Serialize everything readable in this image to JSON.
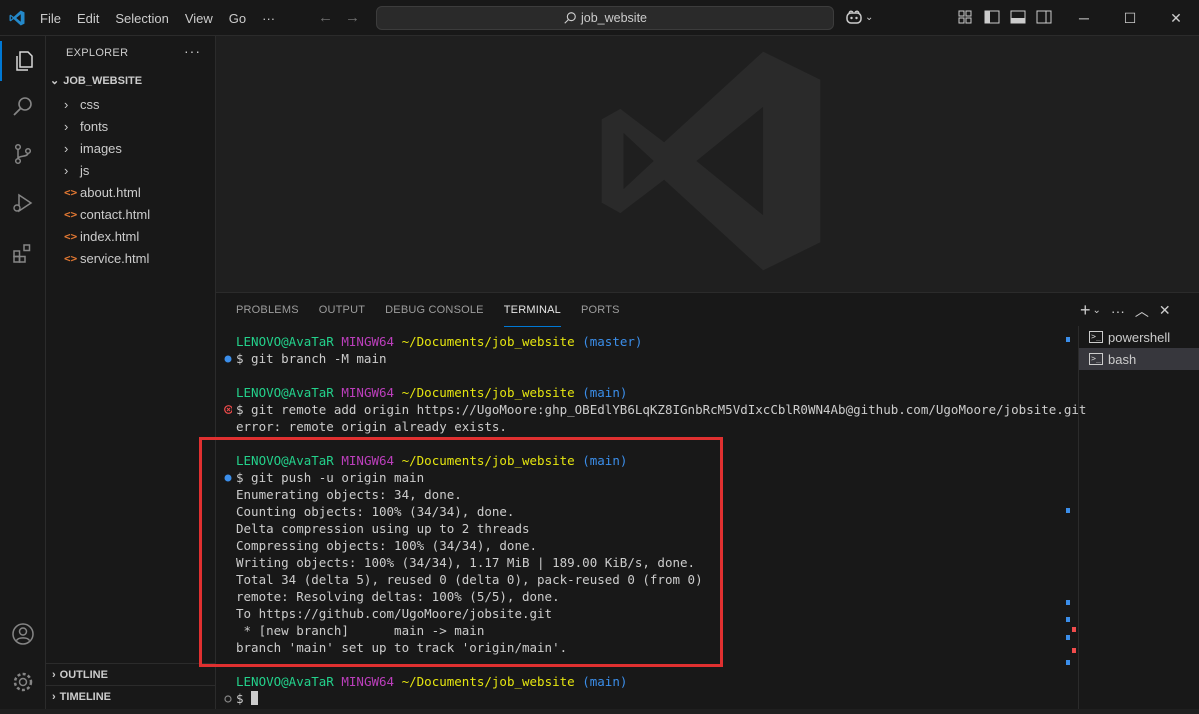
{
  "titlebar": {
    "menu": [
      "File",
      "Edit",
      "Selection",
      "View",
      "Go",
      "···"
    ],
    "search_text": "job_website"
  },
  "sidebar": {
    "header": "EXPLORER",
    "more": "···",
    "root": "JOB_WEBSITE",
    "folders": [
      "css",
      "fonts",
      "images",
      "js"
    ],
    "files": [
      "about.html",
      "contact.html",
      "index.html",
      "service.html"
    ],
    "file_icon": "<>",
    "outline": "OUTLINE",
    "timeline": "TIMELINE"
  },
  "panel": {
    "tabs": [
      "PROBLEMS",
      "OUTPUT",
      "DEBUG CONSOLE",
      "TERMINAL",
      "PORTS"
    ],
    "active_tab": "TERMINAL"
  },
  "terminal": {
    "prompts": [
      {
        "user": "LENOVO@AvaTaR",
        "sys": "MINGW64",
        "path": "~/Documents/job_website",
        "branch": "(master)"
      },
      {
        "user": "LENOVO@AvaTaR",
        "sys": "MINGW64",
        "path": "~/Documents/job_website",
        "branch": "(main)"
      },
      {
        "user": "LENOVO@AvaTaR",
        "sys": "MINGW64",
        "path": "~/Documents/job_website",
        "branch": "(main)"
      },
      {
        "user": "LENOVO@AvaTaR",
        "sys": "MINGW64",
        "path": "~/Documents/job_website",
        "branch": "(main)"
      }
    ],
    "commands": [
      "$ git branch -M main",
      "$ git remote add origin https://UgoMoore: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@github.com/UgoMoore/jobsite.git",
      "$ git push -u origin main",
      "$ "
    ],
    "output_error": [
      "error: remote origin already exists."
    ],
    "output_push": [
      "Enumerating objects: 34, done.",
      "Counting objects: 100% (34/34), done.",
      "Delta compression using up to 2 threads",
      "Compressing objects: 100% (34/34), done.",
      "Writing objects: 100% (34/34), 1.17 MiB | 189.00 KiB/s, done.",
      "Total 34 (delta 5), reused 0 (delta 0), pack-reused 0 (from 0)",
      "remote: Resolving deltas: 100% (5/5), done.",
      "To https://github.com/UgoMoore/jobsite.git",
      " * [new branch]      main -> main",
      "branch 'main' set up to track 'origin/main'."
    ]
  },
  "terminal_list": [
    "powershell",
    "bash"
  ],
  "colors": {
    "accent": "#0078d4",
    "prompt_user": "#23d18b",
    "prompt_sys": "#bc3fbc",
    "prompt_path": "#e5e510",
    "prompt_branch": "#3b8eea",
    "error_dot": "#f14c4c",
    "highlight_box": "#e03030"
  }
}
